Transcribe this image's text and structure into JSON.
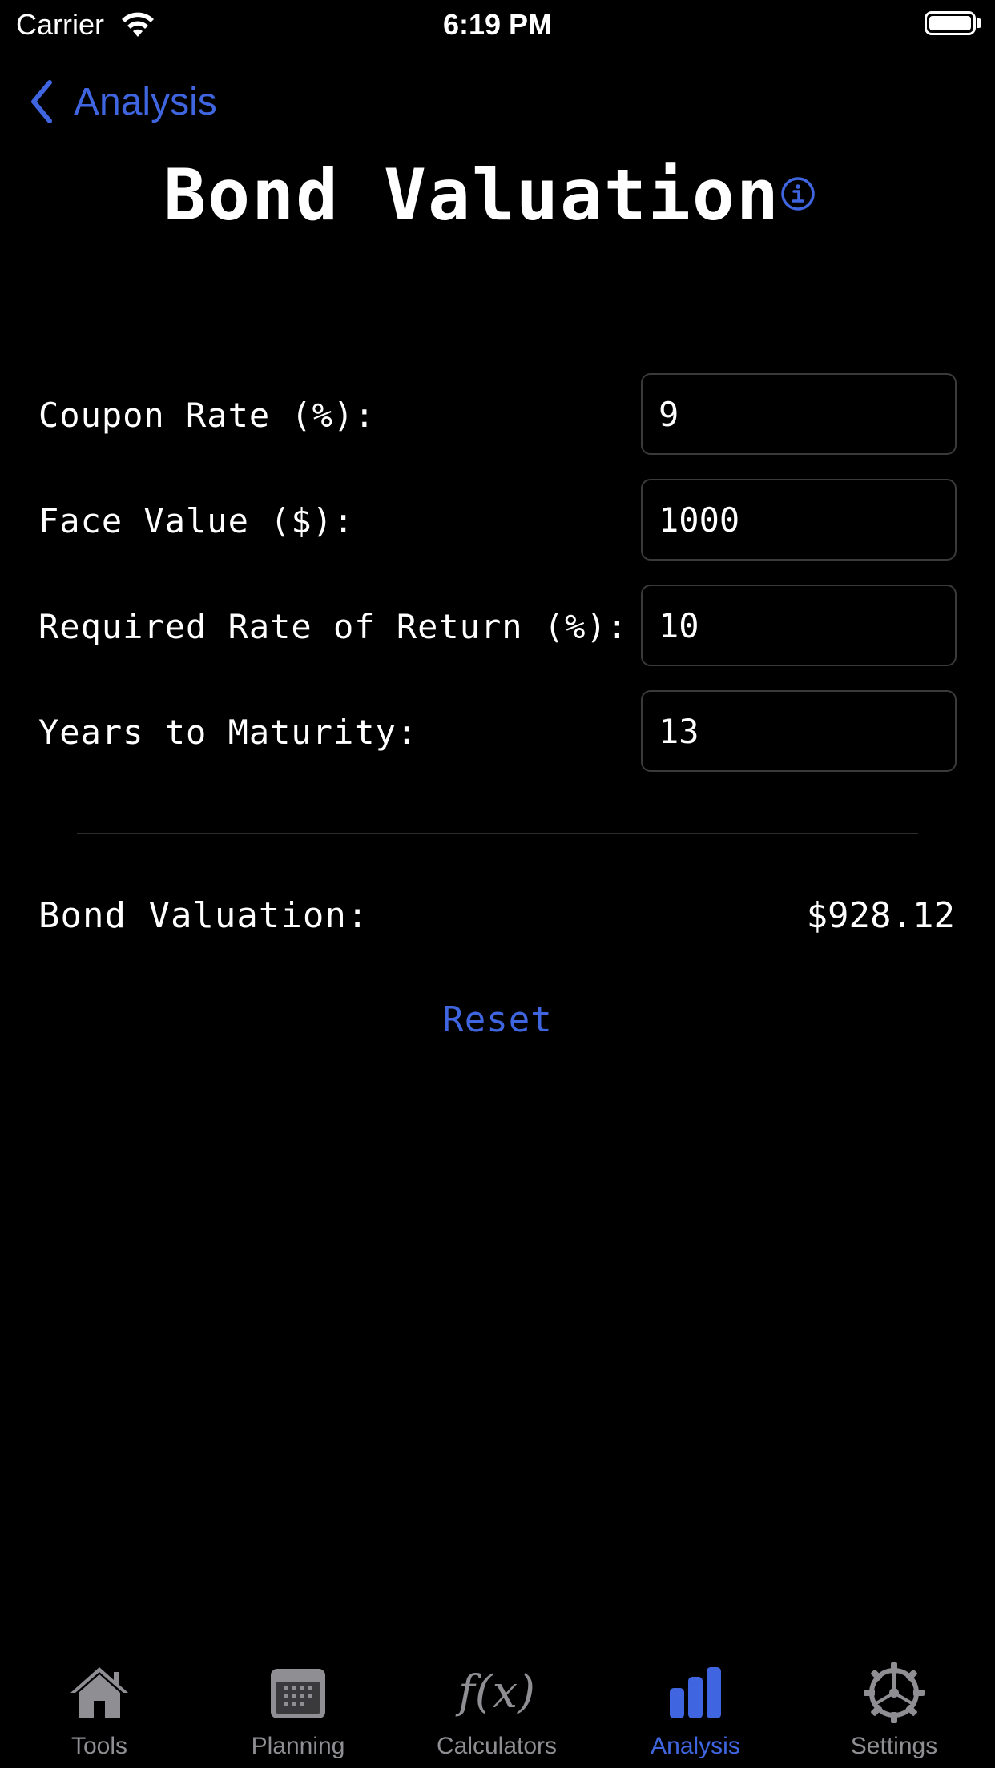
{
  "status_bar": {
    "carrier": "Carrier",
    "time": "6:19 PM"
  },
  "nav": {
    "back_label": "Analysis"
  },
  "page": {
    "title": "Bond Valuation"
  },
  "form": {
    "fields": [
      {
        "label": "Coupon Rate (%):",
        "value": "9"
      },
      {
        "label": "Face Value ($):",
        "value": "1000"
      },
      {
        "label": "Required Rate of Return (%):",
        "value": "10"
      },
      {
        "label": "Years to Maturity:",
        "value": "13"
      }
    ]
  },
  "result": {
    "label": "Bond Valuation:",
    "value": "$928.12"
  },
  "actions": {
    "reset_label": "Reset"
  },
  "tab_bar": {
    "tabs": [
      {
        "label": "Tools",
        "icon": "house-icon"
      },
      {
        "label": "Planning",
        "icon": "calendar-icon"
      },
      {
        "label": "Calculators",
        "icon": "function-icon",
        "glyph": "f(x)"
      },
      {
        "label": "Analysis",
        "icon": "chart-icon"
      },
      {
        "label": "Settings",
        "icon": "gear-icon"
      }
    ],
    "active": "Analysis"
  },
  "colors": {
    "accent": "#3f66e0",
    "inactive": "#8e8e93",
    "background": "#000000"
  }
}
